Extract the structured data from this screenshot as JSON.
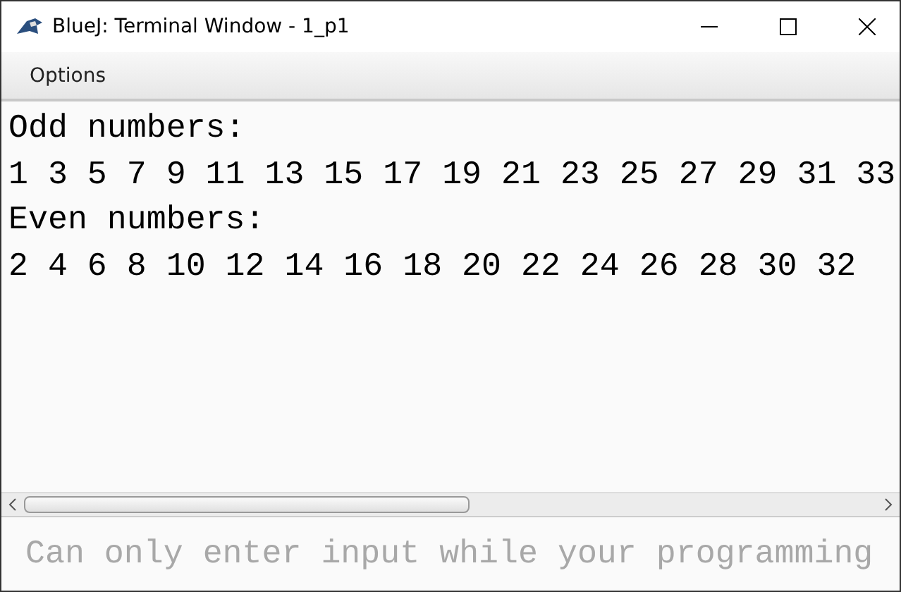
{
  "window": {
    "title": "BlueJ: Terminal Window - 1_p1"
  },
  "menu": [
    "Options"
  ],
  "output": [
    "Odd numbers:",
    "1 3 5 7 9 11 13 15 17 19 21 23 25 27 29 31 33",
    "Even numbers:",
    "2 4 6 8 10 12 14 16 18 20 22 24 26 28 30 32"
  ],
  "input": {
    "placeholder": "Can only enter input while your programming",
    "disabled": true
  }
}
